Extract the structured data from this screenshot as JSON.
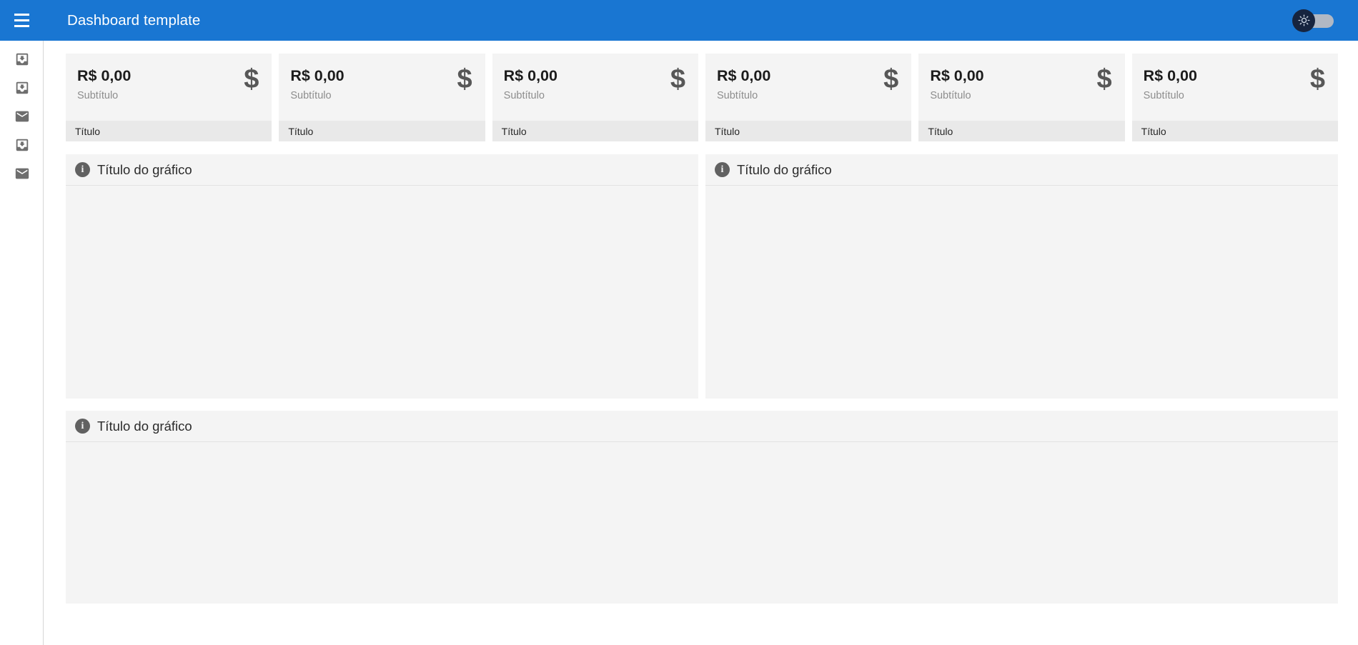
{
  "appbar": {
    "title": "Dashboard template",
    "menu_label": "menu",
    "theme_toggle": {
      "name": "dark-mode-toggle",
      "state": "off",
      "icon": "sun-icon"
    },
    "background_color": "#1976d2"
  },
  "sidebar": {
    "items": [
      {
        "icon": "move-to-inbox-icon",
        "label": ""
      },
      {
        "icon": "move-to-inbox-icon",
        "label": ""
      },
      {
        "icon": "mail-icon",
        "label": ""
      },
      {
        "icon": "move-to-inbox-icon",
        "label": ""
      },
      {
        "icon": "mail-icon",
        "label": ""
      }
    ]
  },
  "stat_cards": [
    {
      "value": "R$ 0,00",
      "subtitle": "Subtítulo",
      "title": "Título",
      "icon": "$"
    },
    {
      "value": "R$ 0,00",
      "subtitle": "Subtítulo",
      "title": "Título",
      "icon": "$"
    },
    {
      "value": "R$ 0,00",
      "subtitle": "Subtítulo",
      "title": "Título",
      "icon": "$"
    },
    {
      "value": "R$ 0,00",
      "subtitle": "Subtítulo",
      "title": "Título",
      "icon": "$"
    },
    {
      "value": "R$ 0,00",
      "subtitle": "Subtítulo",
      "title": "Título",
      "icon": "$"
    },
    {
      "value": "R$ 0,00",
      "subtitle": "Subtítulo",
      "title": "Título",
      "icon": "$"
    }
  ],
  "chart_cards": [
    {
      "title": "Título do gráfico",
      "icon": "info-icon"
    },
    {
      "title": "Título do gráfico",
      "icon": "info-icon"
    },
    {
      "title": "Título do gráfico",
      "icon": "info-icon"
    }
  ],
  "colors": {
    "primary": "#1976d2",
    "card_bg": "#f4f4f4",
    "card_footer_bg": "#e9e9e9",
    "icon_gray": "#616161",
    "text_primary": "#1c1c1c",
    "text_muted": "#8d8d8d"
  }
}
